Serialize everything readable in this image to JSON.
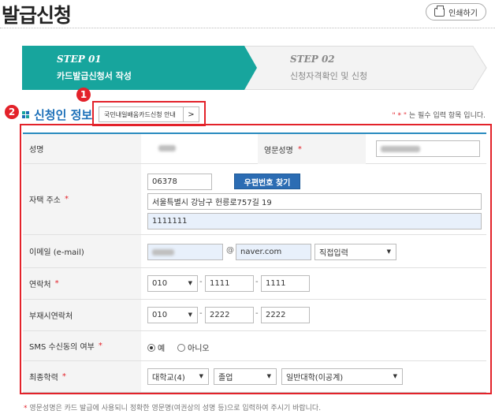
{
  "page_title": "발급신청",
  "print_label": "인쇄하기",
  "steps": [
    {
      "num": "STEP 01",
      "label": "카드발급신청서 작성"
    },
    {
      "num": "STEP 02",
      "label": "신청자격확인 및 신청"
    }
  ],
  "section_title": "신청인 정보",
  "guide_label": "국민내일배움카드신청 안내",
  "guide_arrow": ">",
  "badges": [
    "1",
    "2"
  ],
  "required_note": {
    "star": "\" * \"",
    "text": "는 필수 입력 항목 입니다."
  },
  "form": {
    "name_label": "성명",
    "eng_name_label": "영문성명",
    "address_label": "자택 주소",
    "zip": "06378",
    "zip_button": "우편번호 찾기",
    "address1": "서울특별시 강남구 헌릉로757길 19",
    "address2": "1111111",
    "email_label": "이메일 (e-mail)",
    "at": "@",
    "email_domain": "naver.com",
    "email_select": "직접입력",
    "phone_label": "연락처",
    "phone": [
      "010",
      "1111",
      "1111"
    ],
    "alt_phone_label": "부재시연락처",
    "alt_phone": [
      "010",
      "2222",
      "2222"
    ],
    "sms_label": "SMS 수신동의 여부",
    "sms_yes": "예",
    "sms_no": "아니오",
    "edu_label": "최종학력",
    "edu": [
      "대학교(4)",
      "졸업",
      "일반대학(이공계)"
    ],
    "req_star": "*",
    "dash": "-"
  },
  "footer_note": {
    "star": "*",
    "text": "영문성명은 카드 발급에 사용되니 정확한 영문명(여권상의 성명 등)으로 입력하여 주시기 바랍니다."
  },
  "colors": {
    "accent": "#17a59d",
    "highlight": "#e3222a",
    "button": "#2b6cb3"
  }
}
